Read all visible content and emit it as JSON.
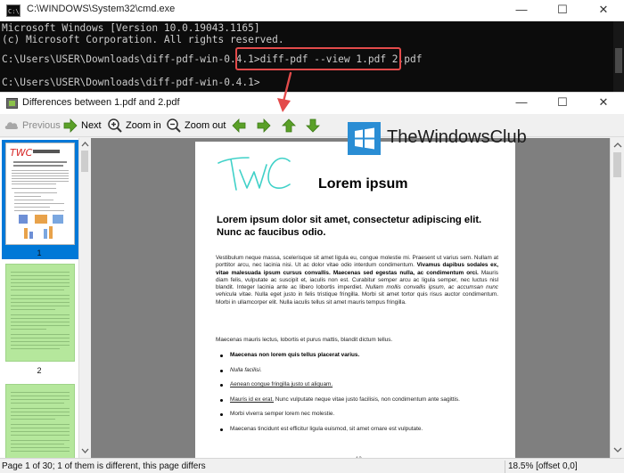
{
  "cmd": {
    "title": "C:\\WINDOWS\\System32\\cmd.exe",
    "icon_label": "C:\\",
    "lines": [
      "Microsoft Windows [Version 10.0.19043.1165]",
      "(c) Microsoft Corporation. All rights reserved.",
      "",
      "C:\\Users\\USER\\Downloads\\diff-pdf-win-0.4.1>diff-pdf --view 1.pdf 2.pdf",
      "",
      "C:\\Users\\USER\\Downloads\\diff-pdf-win-0.4.1>"
    ]
  },
  "window_controls": {
    "minimize": "—",
    "maximize": "☐",
    "close": "✕"
  },
  "diff_window": {
    "title": "Differences between 1.pdf and 2.pdf",
    "toolbar": {
      "previous": "Previous",
      "next": "Next",
      "zoom_in": "Zoom in",
      "zoom_out": "Zoom out"
    },
    "thumbnails": [
      {
        "number": "1",
        "selected": true
      },
      {
        "number": "2",
        "selected": false
      }
    ],
    "page": {
      "annotation": "TWC",
      "heading": "Lorem ipsum",
      "subheading": "Lorem ipsum dolor sit amet, consectetur adipiscing elit. Nunc ac faucibus odio.",
      "para1_a": "Vestibulum neque massa, scelerisque sit amet ligula eu, congue molestie mi. Praesent ut varius sem. Nullam at porttitor arcu, nec lacinia nisi. Ut ac dolor vitae odio interdum condimentum. ",
      "para1_b": "Vivamus dapibus sodales ex, vitae malesuada ipsum cursus convallis. Maecenas sed egestas nulla, ac condimentum orci.",
      "para1_c": " Mauris diam felis, vulputate ac suscipit et, iaculis non est. Curabitur semper arcu ac ligula semper, nec luctus nisl blandit. Integer lacinia ante ac libero lobortis imperdiet. ",
      "para1_d": "Nullam mollis convallis ipsum, ac accumsan nunc vehicula vitae.",
      "para1_e": " Nulla eget justo in felis tristique fringilla. Morbi sit amet tortor quis risus auctor condimentum. Morbi in ullamcorper elit. Nulla iaculis tellus sit amet mauris tempus fringilla.",
      "para2": "Maecenas mauris lectus, lobortis et purus mattis, blandit dictum tellus.",
      "bullet1": "Maecenas non lorem quis tellus placerat varius.",
      "bullet2": "Nulla facilisi.",
      "bullet3": "Aenean congue fringilla justo ut aliquam.",
      "bullet4_link": "Mauris id ex erat.",
      "bullet4_rest": " Nunc vulputate neque vitae justo facilisis, non condimentum ante sagittis.",
      "bullet5": "Morbi viverra semper lorem nec molestie.",
      "bullet6": "Maecenas tincidunt est efficitur ligula euismod, sit amet ornare est vulputate.",
      "page_number": "12"
    },
    "status_left": "Page 1 of 30; 1 of them is different, this page differs",
    "status_right": "18.5% [offset 0,0]"
  },
  "watermark": {
    "text": "TheWindowsClub"
  },
  "colors": {
    "highlight_box": "#e34b4b",
    "arrow_green": "#5aa028",
    "diff_green": "#b5e79c",
    "selection_blue": "#0078d7",
    "watermark_blue": "#2a8dd4"
  }
}
